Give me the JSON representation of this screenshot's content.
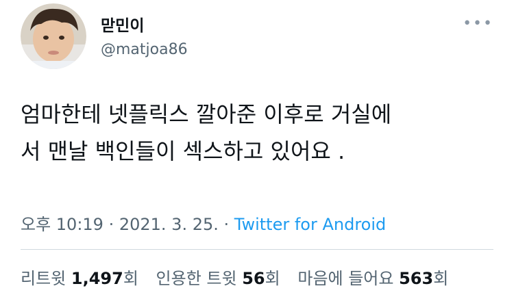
{
  "profile": {
    "display_name": "맏민이",
    "handle": "@matjoa86"
  },
  "menu": {
    "more_label": "•••"
  },
  "tweet": {
    "line1": "엄마한테 넷플릭스 깔아준 이후로 거실에",
    "line2": "서 맨날 백인들이 섹스하고 있어요 ."
  },
  "meta": {
    "time": "오후 10:19",
    "separator": " · ",
    "date": "2021. 3. 25.",
    "source": "Twitter for Android"
  },
  "stats": {
    "retweets_label": "리트윗",
    "retweets_count": "1,497",
    "retweets_unit": "회",
    "quotes_label": "인용한 트윗",
    "quotes_count": "56",
    "quotes_unit": "회",
    "likes_label": "마음에 들어요",
    "likes_count": "563",
    "likes_unit": "회"
  }
}
